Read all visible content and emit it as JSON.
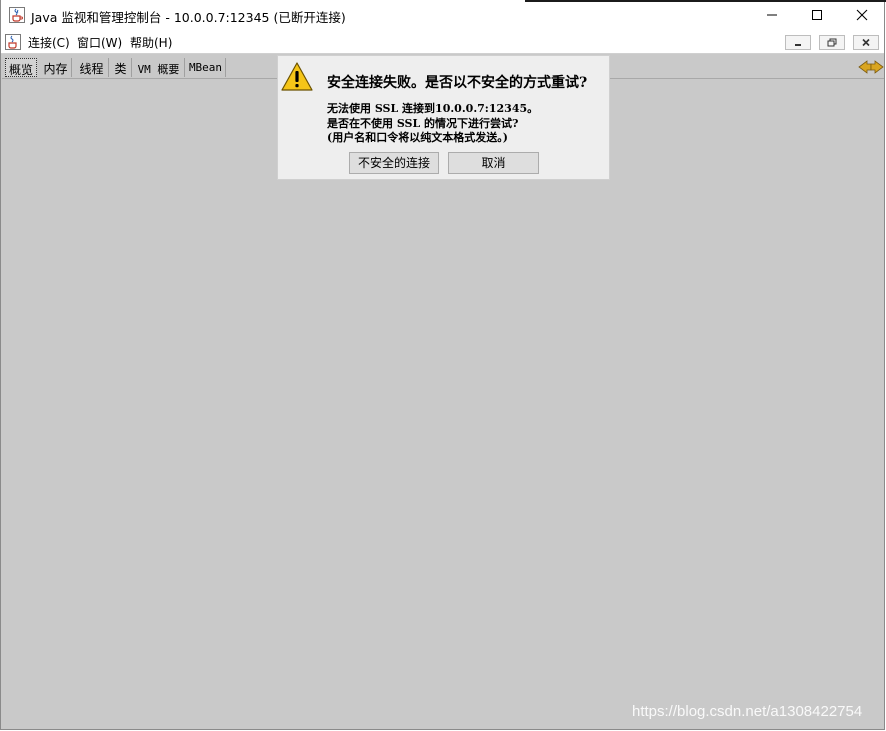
{
  "window": {
    "title": "Java 监视和管理控制台 - 10.0.0.7:12345 (已断开连接)",
    "controls": {
      "minimize": "minimize-icon",
      "maximize": "maximize-icon",
      "close": "close-icon"
    }
  },
  "menubar": {
    "items": [
      {
        "label": "连接(C)"
      },
      {
        "label": "窗口(W)"
      },
      {
        "label": "帮助(H)"
      }
    ],
    "mdi_buttons": [
      "minimize-icon",
      "restore-icon",
      "close-icon"
    ]
  },
  "tabs": [
    {
      "label": "概览",
      "selected": true
    },
    {
      "label": "内存"
    },
    {
      "label": "线程"
    },
    {
      "label": "类"
    },
    {
      "label": "VM 概要"
    },
    {
      "label": "MBean"
    }
  ],
  "dialog": {
    "title": "安全连接失败。是否以不安全的方式重试?",
    "lines": [
      "无法使用 SSL 连接到10.0.0.7:12345。",
      "是否在不使用 SSL 的情况下进行尝试?",
      "(用户名和口令将以纯文本格式发送。)"
    ],
    "buttons": {
      "insecure": "不安全的连接",
      "cancel": "取消"
    }
  },
  "watermark": "https://blog.csdn.net/a1308422754",
  "colors": {
    "content_bg": "#c9c9c9",
    "dialog_bg": "#eeeeee",
    "warning_yellow": "#f5c518"
  }
}
